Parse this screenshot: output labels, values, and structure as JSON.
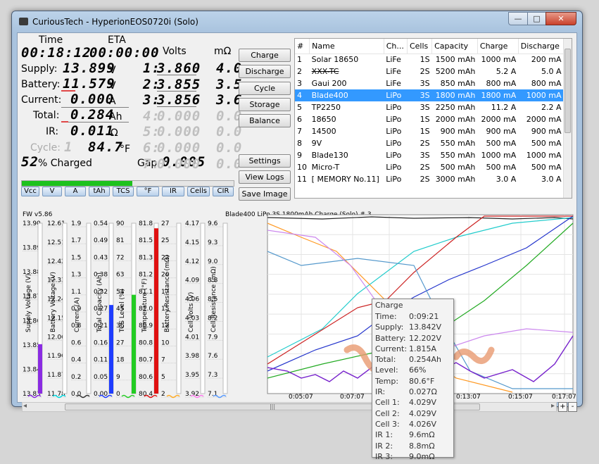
{
  "window": {
    "title": "CuriousTech - HyperionEOS0720i (Solo)"
  },
  "panel": {
    "time_label": "Time",
    "eta_label": "ETA",
    "volts_label": "Volts",
    "mohm_label": "mΩ",
    "time": "00:18:12",
    "eta": "00:00:00",
    "supply_label": "Supply:",
    "supply": "13.899",
    "supply_unit": "V",
    "battery_label": "Battery:",
    "battery": "11.579",
    "battery_unit": "V",
    "current_label": "Current:",
    "current": "0.000",
    "current_unit": "A",
    "total_label": "Total:",
    "total": "0.284",
    "total_unit": "Ah",
    "ir_label": "IR:",
    "ir": "0.011",
    "ir_unit": "Ω",
    "cycle_label": "Cycle:",
    "cycle": "1",
    "temp": "84.7",
    "temp_unit": "°F",
    "charged_pct": "52",
    "charged_label": "% Charged",
    "gap_label": "Gap:",
    "gap": "0.005",
    "charge_progress": 52,
    "cells": [
      {
        "idx": "1:",
        "volts": "3.860",
        "mohm": "4.0",
        "active": true
      },
      {
        "idx": "2:",
        "volts": "3.855",
        "mohm": "3.5",
        "active": true
      },
      {
        "idx": "3:",
        "volts": "3.856",
        "mohm": "3.6",
        "active": true
      },
      {
        "idx": "4:",
        "volts": "0.000",
        "mohm": "0.0",
        "active": false
      },
      {
        "idx": "5:",
        "volts": "0.000",
        "mohm": "0.0",
        "active": false
      },
      {
        "idx": "6:",
        "volts": "0.000",
        "mohm": "0.0",
        "active": false
      },
      {
        "idx": "7:",
        "volts": "0.000",
        "mohm": "0.0",
        "active": false
      }
    ]
  },
  "buttons": {
    "charge": "Charge",
    "discharge": "Discharge",
    "cycle": "Cycle",
    "storage": "Storage",
    "balance": "Balance",
    "settings": "Settings",
    "view_logs": "View Logs",
    "save_image": "Save Image"
  },
  "toggles": [
    "Vcc",
    "V",
    "A",
    "tAh",
    "TCS",
    "°F",
    "IR",
    "Cells",
    "CIR"
  ],
  "table": {
    "headers": [
      "#",
      "Name",
      "Ch...",
      "Cells",
      "Capacity",
      "Charge",
      "Discharge"
    ],
    "rows": [
      [
        "1",
        "Solar 18650",
        "LiFe",
        "1S",
        "1500 mAh",
        "1000 mA",
        "200 mA"
      ],
      [
        "2",
        "XXX-TC",
        "LiFe",
        "2S",
        "5200 mAh",
        "5.2 A",
        "5.0 A"
      ],
      [
        "3",
        "Gaui 200",
        "LiFe",
        "3S",
        "850 mAh",
        "800 mA",
        "800 mA"
      ],
      [
        "4",
        "Blade400",
        "LiPo",
        "3S",
        "1800 mAh",
        "1800 mA",
        "1000 mA"
      ],
      [
        "5",
        "TP2250",
        "LiPo",
        "3S",
        "2250 mAh",
        "11.2 A",
        "2.2 A"
      ],
      [
        "6",
        "18650",
        "LiPo",
        "1S",
        "2000 mAh",
        "2000 mA",
        "2000 mA"
      ],
      [
        "7",
        "14500",
        "LiPo",
        "1S",
        "900 mAh",
        "900 mA",
        "900 mA"
      ],
      [
        "8",
        "9V",
        "LiPo",
        "2S",
        "550 mAh",
        "500 mA",
        "500 mA"
      ],
      [
        "9",
        "Blade130",
        "LiPo",
        "3S",
        "550 mAh",
        "1000 mA",
        "1000 mA"
      ],
      [
        "10",
        "Micro-T",
        "LiPo",
        "2S",
        "500 mAh",
        "500 mA",
        "500 mA"
      ],
      [
        "11",
        "[ MEMORY No.11]",
        "LiPo",
        "2S",
        "3000 mAh",
        "3.0 A",
        "3.0 A"
      ]
    ],
    "selected": 3
  },
  "graph": {
    "fw": "FW v5.86",
    "header": "Blade400   LiPo   3S  1800mAh   Charge (Solo) # 3",
    "gauges": [
      {
        "name": "Supply Voltage (V)",
        "ticks": [
          "13.90",
          "13.89",
          "13.88",
          "13.87",
          "13.86",
          "13.85",
          "13.84",
          "13.83"
        ],
        "color": "#8a2be2",
        "level": 0.29
      },
      {
        "name": "Battery Voltage (V)",
        "ticks": [
          "12.61",
          "12.51",
          "12.42",
          "12.33",
          "12.24",
          "12.15",
          "12.06",
          "11.96",
          "11.87",
          "11.78"
        ],
        "color": "#00d8e0",
        "level": 0.0
      },
      {
        "name": "Current (A)",
        "ticks": [
          "1.9",
          "1.7",
          "1.5",
          "1.3",
          "1.1",
          "0.9",
          "0.8",
          "0.6",
          "0.4",
          "0.2",
          "0.0"
        ],
        "color": "#333333",
        "level": 0.0
      },
      {
        "name": "Total Capacity (Ah)",
        "ticks": [
          "0.54",
          "0.49",
          "0.43",
          "0.38",
          "0.32",
          "0.27",
          "0.21",
          "0.16",
          "0.11",
          "0.05",
          "0.00"
        ],
        "color": "#1e3cff",
        "level": 0.52
      },
      {
        "name": "TCS Level (%)",
        "ticks": [
          "90",
          "81",
          "72",
          "63",
          "54",
          "45",
          "36",
          "27",
          "18",
          "9",
          "0"
        ],
        "color": "#22cc22",
        "level": 0.58
      },
      {
        "name": "Temperature (°F)",
        "ticks": [
          "81.8",
          "81.5",
          "81.3",
          "81.2",
          "81.1",
          "81.0",
          "80.9",
          "80.8",
          "80.7",
          "80.6",
          "80.4"
        ],
        "color": "#e01010",
        "level": 0.97
      },
      {
        "name": "Battery Resistance (mΩ)",
        "ticks": [
          "27",
          "25",
          "22",
          "20",
          "17",
          "15",
          "12",
          "10",
          "7",
          "5",
          "2"
        ],
        "color": "#ffaa22",
        "level": 0.0
      },
      {
        "name": "Cell Volts (V)",
        "ticks": [
          "4.17",
          "4.15",
          "4.12",
          "4.09",
          "4.06",
          "4.03",
          "4.01",
          "3.98",
          "3.95",
          "3.92"
        ],
        "color": "#ff77ee",
        "level": 0.0
      },
      {
        "name": "Cell Resistance (mΩ)",
        "ticks": [
          "9.6",
          "9.3",
          "9.0",
          "8.8",
          "8.5",
          "8.2",
          "7.9",
          "7.6",
          "7.3",
          "7.1"
        ],
        "color": "#5599ff",
        "level": 0.0
      }
    ],
    "xticks": [
      "0:05:07",
      "0:07:07",
      "0:09",
      "0:13:07",
      "0:15:07",
      "0:17:07"
    ]
  },
  "tooltip": {
    "title": "Charge",
    "rows": [
      [
        "Time:",
        "0:09:21"
      ],
      [
        "Supply:",
        "13.842V"
      ],
      [
        "Battery:",
        "12.202V"
      ],
      [
        "Current:",
        "1.815A"
      ],
      [
        "Total:",
        "0.254Ah"
      ],
      [
        "Level:",
        "66%"
      ],
      [
        "Temp:",
        "80.6°F"
      ],
      [
        "IR:",
        "0.027Ω"
      ],
      [
        "Cell 1:",
        "4.029V"
      ],
      [
        "Cell 2:",
        "4.029V"
      ],
      [
        "Cell 3:",
        "4.026V"
      ],
      [
        "IR 1:",
        "9.6mΩ"
      ],
      [
        "IR 2:",
        "8.8mΩ"
      ],
      [
        "IR 3:",
        "9.0mΩ"
      ]
    ]
  },
  "scroll": {
    "thumb_glyph": "|||",
    "left_arrow": "◂",
    "right_arrow": "▸",
    "plus": "+",
    "minus": "-"
  },
  "colors": {
    "selection": "#3399ff",
    "progress": "#1dc21d",
    "highlight_line": "#e04848"
  }
}
